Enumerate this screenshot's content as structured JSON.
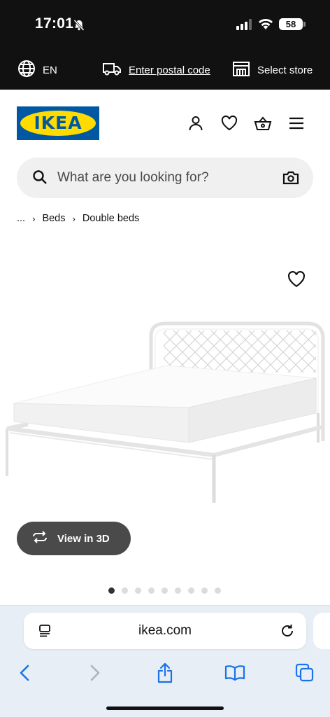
{
  "status": {
    "time": "17:01",
    "battery": "58"
  },
  "utility": {
    "language": "EN",
    "postal_label": "Enter postal code",
    "store_label": "Select store"
  },
  "header": {
    "logo_text": "IKEA",
    "brand_blue": "#0058a3",
    "brand_yellow": "#ffdb00"
  },
  "search": {
    "placeholder": "What are you looking for?"
  },
  "breadcrumb": {
    "ellipsis": "...",
    "items": [
      "Beds",
      "Double beds"
    ]
  },
  "product": {
    "view3d_label": "View in 3D",
    "carousel_total": 9,
    "carousel_active": 1
  },
  "browser": {
    "url": "ikea.com"
  }
}
